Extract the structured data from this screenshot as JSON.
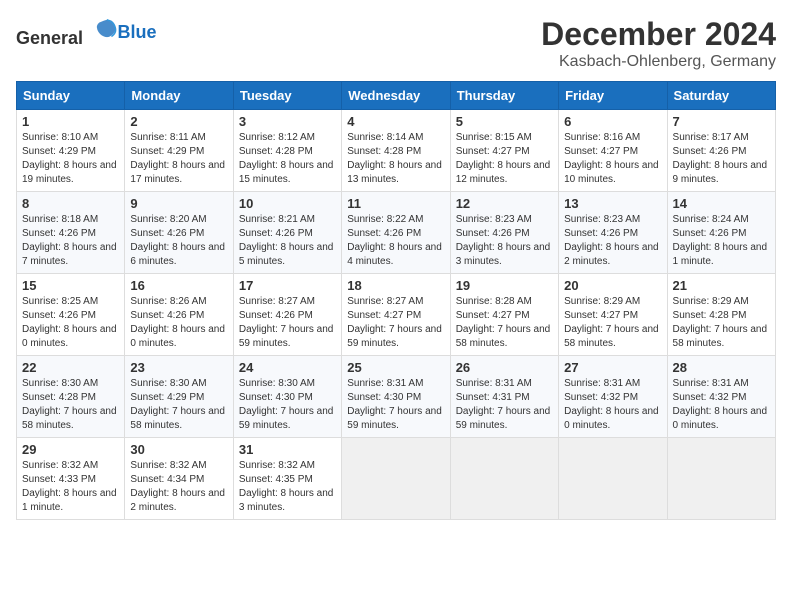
{
  "header": {
    "logo_general": "General",
    "logo_blue": "Blue",
    "month_title": "December 2024",
    "location": "Kasbach-Ohlenberg, Germany"
  },
  "weekdays": [
    "Sunday",
    "Monday",
    "Tuesday",
    "Wednesday",
    "Thursday",
    "Friday",
    "Saturday"
  ],
  "weeks": [
    [
      {
        "day": 1,
        "sunrise": "8:10 AM",
        "sunset": "4:29 PM",
        "daylight": "8 hours and 19 minutes."
      },
      {
        "day": 2,
        "sunrise": "8:11 AM",
        "sunset": "4:29 PM",
        "daylight": "8 hours and 17 minutes."
      },
      {
        "day": 3,
        "sunrise": "8:12 AM",
        "sunset": "4:28 PM",
        "daylight": "8 hours and 15 minutes."
      },
      {
        "day": 4,
        "sunrise": "8:14 AM",
        "sunset": "4:28 PM",
        "daylight": "8 hours and 13 minutes."
      },
      {
        "day": 5,
        "sunrise": "8:15 AM",
        "sunset": "4:27 PM",
        "daylight": "8 hours and 12 minutes."
      },
      {
        "day": 6,
        "sunrise": "8:16 AM",
        "sunset": "4:27 PM",
        "daylight": "8 hours and 10 minutes."
      },
      {
        "day": 7,
        "sunrise": "8:17 AM",
        "sunset": "4:26 PM",
        "daylight": "8 hours and 9 minutes."
      }
    ],
    [
      {
        "day": 8,
        "sunrise": "8:18 AM",
        "sunset": "4:26 PM",
        "daylight": "8 hours and 7 minutes."
      },
      {
        "day": 9,
        "sunrise": "8:20 AM",
        "sunset": "4:26 PM",
        "daylight": "8 hours and 6 minutes."
      },
      {
        "day": 10,
        "sunrise": "8:21 AM",
        "sunset": "4:26 PM",
        "daylight": "8 hours and 5 minutes."
      },
      {
        "day": 11,
        "sunrise": "8:22 AM",
        "sunset": "4:26 PM",
        "daylight": "8 hours and 4 minutes."
      },
      {
        "day": 12,
        "sunrise": "8:23 AM",
        "sunset": "4:26 PM",
        "daylight": "8 hours and 3 minutes."
      },
      {
        "day": 13,
        "sunrise": "8:23 AM",
        "sunset": "4:26 PM",
        "daylight": "8 hours and 2 minutes."
      },
      {
        "day": 14,
        "sunrise": "8:24 AM",
        "sunset": "4:26 PM",
        "daylight": "8 hours and 1 minute."
      }
    ],
    [
      {
        "day": 15,
        "sunrise": "8:25 AM",
        "sunset": "4:26 PM",
        "daylight": "8 hours and 0 minutes."
      },
      {
        "day": 16,
        "sunrise": "8:26 AM",
        "sunset": "4:26 PM",
        "daylight": "8 hours and 0 minutes."
      },
      {
        "day": 17,
        "sunrise": "8:27 AM",
        "sunset": "4:26 PM",
        "daylight": "7 hours and 59 minutes."
      },
      {
        "day": 18,
        "sunrise": "8:27 AM",
        "sunset": "4:27 PM",
        "daylight": "7 hours and 59 minutes."
      },
      {
        "day": 19,
        "sunrise": "8:28 AM",
        "sunset": "4:27 PM",
        "daylight": "7 hours and 58 minutes."
      },
      {
        "day": 20,
        "sunrise": "8:29 AM",
        "sunset": "4:27 PM",
        "daylight": "7 hours and 58 minutes."
      },
      {
        "day": 21,
        "sunrise": "8:29 AM",
        "sunset": "4:28 PM",
        "daylight": "7 hours and 58 minutes."
      }
    ],
    [
      {
        "day": 22,
        "sunrise": "8:30 AM",
        "sunset": "4:28 PM",
        "daylight": "7 hours and 58 minutes."
      },
      {
        "day": 23,
        "sunrise": "8:30 AM",
        "sunset": "4:29 PM",
        "daylight": "7 hours and 58 minutes."
      },
      {
        "day": 24,
        "sunrise": "8:30 AM",
        "sunset": "4:30 PM",
        "daylight": "7 hours and 59 minutes."
      },
      {
        "day": 25,
        "sunrise": "8:31 AM",
        "sunset": "4:30 PM",
        "daylight": "7 hours and 59 minutes."
      },
      {
        "day": 26,
        "sunrise": "8:31 AM",
        "sunset": "4:31 PM",
        "daylight": "7 hours and 59 minutes."
      },
      {
        "day": 27,
        "sunrise": "8:31 AM",
        "sunset": "4:32 PM",
        "daylight": "8 hours and 0 minutes."
      },
      {
        "day": 28,
        "sunrise": "8:31 AM",
        "sunset": "4:32 PM",
        "daylight": "8 hours and 0 minutes."
      }
    ],
    [
      {
        "day": 29,
        "sunrise": "8:32 AM",
        "sunset": "4:33 PM",
        "daylight": "8 hours and 1 minute."
      },
      {
        "day": 30,
        "sunrise": "8:32 AM",
        "sunset": "4:34 PM",
        "daylight": "8 hours and 2 minutes."
      },
      {
        "day": 31,
        "sunrise": "8:32 AM",
        "sunset": "4:35 PM",
        "daylight": "8 hours and 3 minutes."
      },
      null,
      null,
      null,
      null
    ]
  ]
}
